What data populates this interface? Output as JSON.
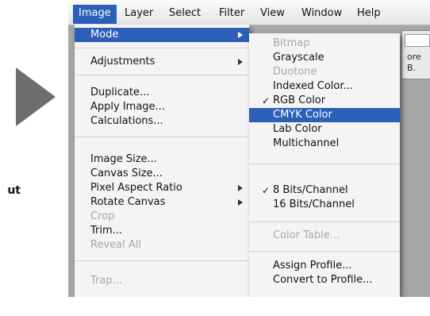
{
  "left": {
    "text_fragment": "ut"
  },
  "menubar": {
    "items": [
      "Image",
      "Layer",
      "Select",
      "Filter",
      "View",
      "Window",
      "Help"
    ]
  },
  "image_menu": {
    "mode": "Mode",
    "adjustments": "Adjustments",
    "duplicate": "Duplicate...",
    "apply_image": "Apply Image...",
    "calculations": "Calculations...",
    "image_size": "Image Size...",
    "canvas_size": "Canvas Size...",
    "pixel_aspect_ratio": "Pixel Aspect Ratio",
    "rotate_canvas": "Rotate Canvas",
    "crop": "Crop",
    "trim": "Trim...",
    "reveal_all": "Reveal All",
    "trap": "Trap..."
  },
  "mode_menu": {
    "bitmap": "Bitmap",
    "grayscale": "Grayscale",
    "duotone": "Duotone",
    "indexed_color": "Indexed Color...",
    "rgb_color": "RGB Color",
    "cmyk_color": "CMYK Color",
    "lab_color": "Lab Color",
    "multichannel": "Multichannel",
    "bits8": "8 Bits/Channel",
    "bits16": "16 Bits/Channel",
    "color_table": "Color Table...",
    "assign_profile": "Assign Profile...",
    "convert_to_profile": "Convert to Profile...",
    "checkmark": "✓"
  },
  "background": {
    "frag1": "ore",
    "frag2": "B."
  }
}
